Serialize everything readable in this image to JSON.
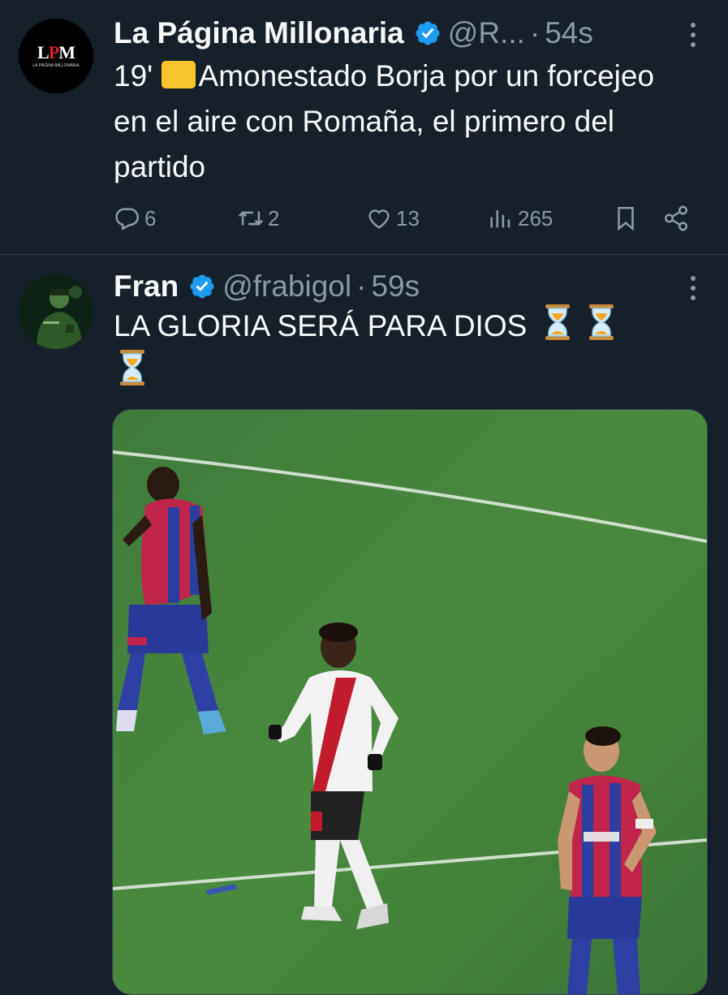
{
  "tweets": [
    {
      "author_name": "La Página Millonaria",
      "handle": "@R...",
      "time": "54s",
      "avatar_logo": "LPM",
      "avatar_sub": "LA PÁGINA MILLONARIA",
      "text_prefix": "19'",
      "text_body": "Amonestado Borja por un forcejeo en el aire con Romaña, el primero del partido",
      "replies": "6",
      "retweets": "2",
      "likes": "13",
      "views": "265"
    },
    {
      "author_name": "Fran",
      "handle": "@frabigol",
      "time": "59s",
      "text": "LA GLORIA SERÁ PARA DIOS",
      "emoji_count": 3,
      "media_description": "football-match-photo"
    }
  ],
  "separator": "·",
  "colors": {
    "background": "#15202b",
    "text": "#f7f9f9",
    "secondary": "#8b98a5",
    "verified": "#1d9bf0",
    "divider": "#38444d"
  },
  "icons": [
    "verified-badge-icon",
    "more-options-icon",
    "reply-icon",
    "retweet-icon",
    "like-icon",
    "views-icon",
    "bookmark-icon",
    "share-icon",
    "yellow-card-emoji",
    "hourglass-emoji"
  ]
}
